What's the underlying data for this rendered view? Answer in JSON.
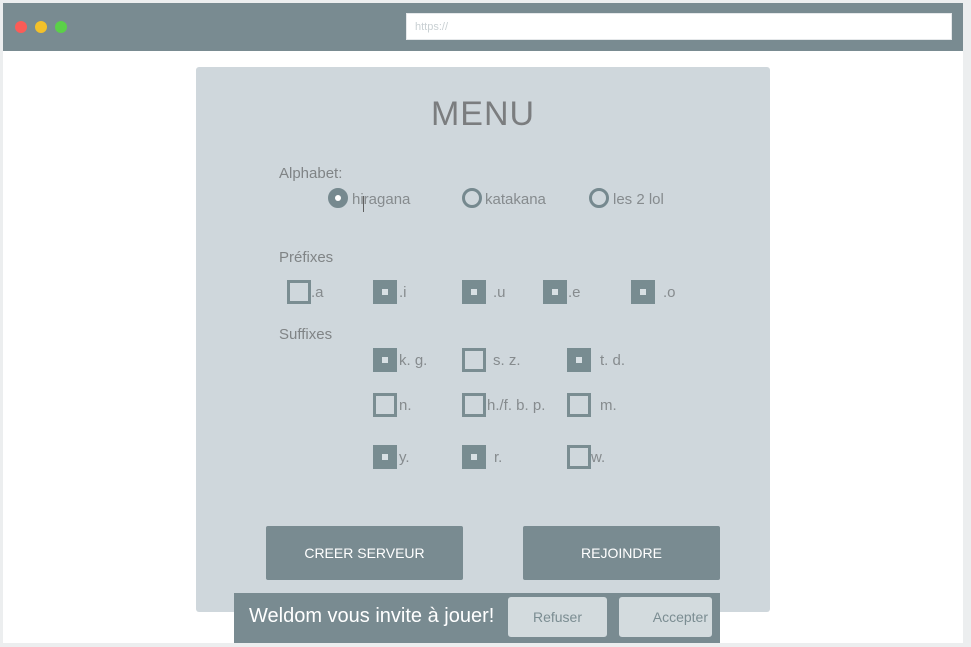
{
  "browser": {
    "url_placeholder": "https://"
  },
  "menu": {
    "title": "MENU",
    "alphabet": {
      "label": "Alphabet:",
      "options": [
        {
          "label": "hiragana",
          "selected": true
        },
        {
          "label": "katakana",
          "selected": false
        },
        {
          "label": "les 2 lol",
          "selected": false
        }
      ]
    },
    "prefixes": {
      "label": "Préfixes",
      "options": [
        {
          "label": ".a",
          "checked": false
        },
        {
          "label": ".i",
          "checked": true
        },
        {
          "label": ".u",
          "checked": true
        },
        {
          "label": ".e",
          "checked": true
        },
        {
          "label": ".o",
          "checked": true
        }
      ]
    },
    "suffixes": {
      "label": "Suffixes",
      "options": [
        {
          "label": "k. g.",
          "checked": true
        },
        {
          "label": "s. z.",
          "checked": false
        },
        {
          "label": "t. d.",
          "checked": true
        },
        {
          "label": "n.",
          "checked": false
        },
        {
          "label": "h./f. b. p.",
          "checked": false
        },
        {
          "label": "m.",
          "checked": false
        },
        {
          "label": "y.",
          "checked": true
        },
        {
          "label": "r.",
          "checked": true
        },
        {
          "label": "w.",
          "checked": false
        }
      ]
    },
    "buttons": {
      "create": "CREER SERVEUR",
      "join": "REJOINDRE"
    }
  },
  "notification": {
    "text": "Weldom vous invite à jouer!",
    "refuse": "Refuser",
    "accept": "Accepter"
  },
  "colors": {
    "titlebar": "#798b91",
    "panel": "#cfd7dc",
    "accent": "#788c91"
  }
}
